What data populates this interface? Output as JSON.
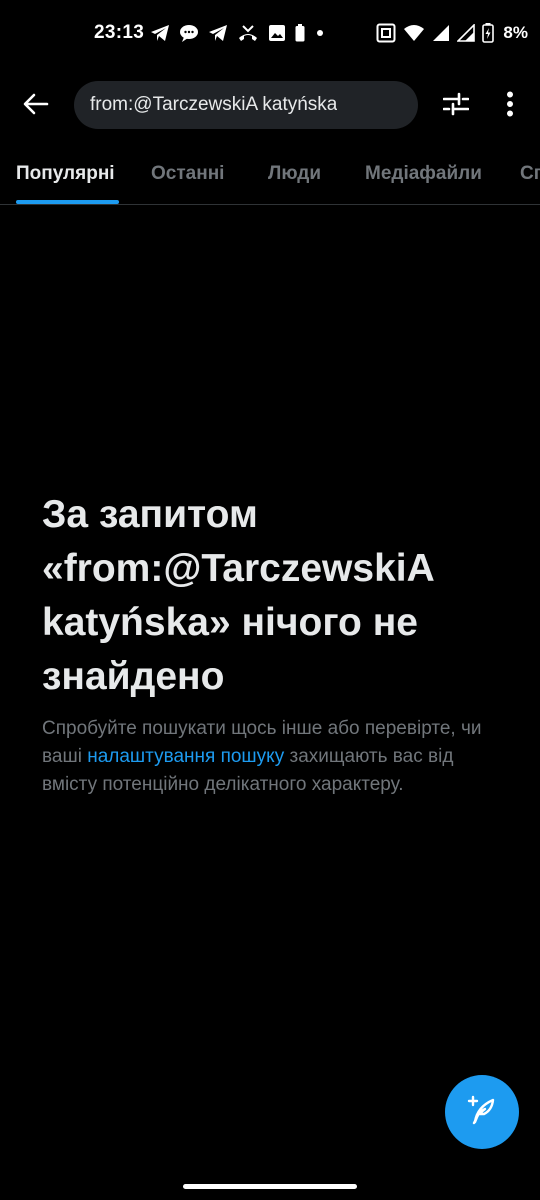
{
  "status_bar": {
    "time": "23:13",
    "battery_percent": "8%",
    "left_icons": [
      "telegram-icon",
      "chat-bubble-icon",
      "telegram-icon",
      "missed-call-icon",
      "gallery-icon",
      "battery-saver-icon",
      "dot-icon"
    ],
    "right_icons": [
      "nfc-icon",
      "wifi-icon",
      "signal-icon",
      "signal-icon",
      "battery-charging-icon"
    ]
  },
  "header": {
    "search_query": "from:@TarczewskiA katyńska",
    "back_icon": "arrow-left-icon",
    "filter_icon": "sliders-icon",
    "more_icon": "more-vertical-icon"
  },
  "tabs": [
    {
      "label": "Популярні",
      "active": true
    },
    {
      "label": "Останні",
      "active": false
    },
    {
      "label": "Люди",
      "active": false
    },
    {
      "label": "Медіафайли",
      "active": false
    },
    {
      "label": "Сп",
      "active": false
    }
  ],
  "empty_state": {
    "title": "За запитом «from:@TarczewskiA katyńska» нічого не знайдено",
    "body_before_link": "Спробуйте пошукати щось інше або перевірте, чи ваші ",
    "link_text": "налаштування пошуку",
    "body_after_link": " захищають вас від вмісту потенційно делікатного характеру."
  },
  "compose_button": {
    "icon": "compose-feather-icon"
  },
  "colors": {
    "background": "#000000",
    "accent": "#1d9bf0",
    "text_primary": "#e7e9ea",
    "text_secondary": "#71767b",
    "search_bg": "#202327"
  }
}
